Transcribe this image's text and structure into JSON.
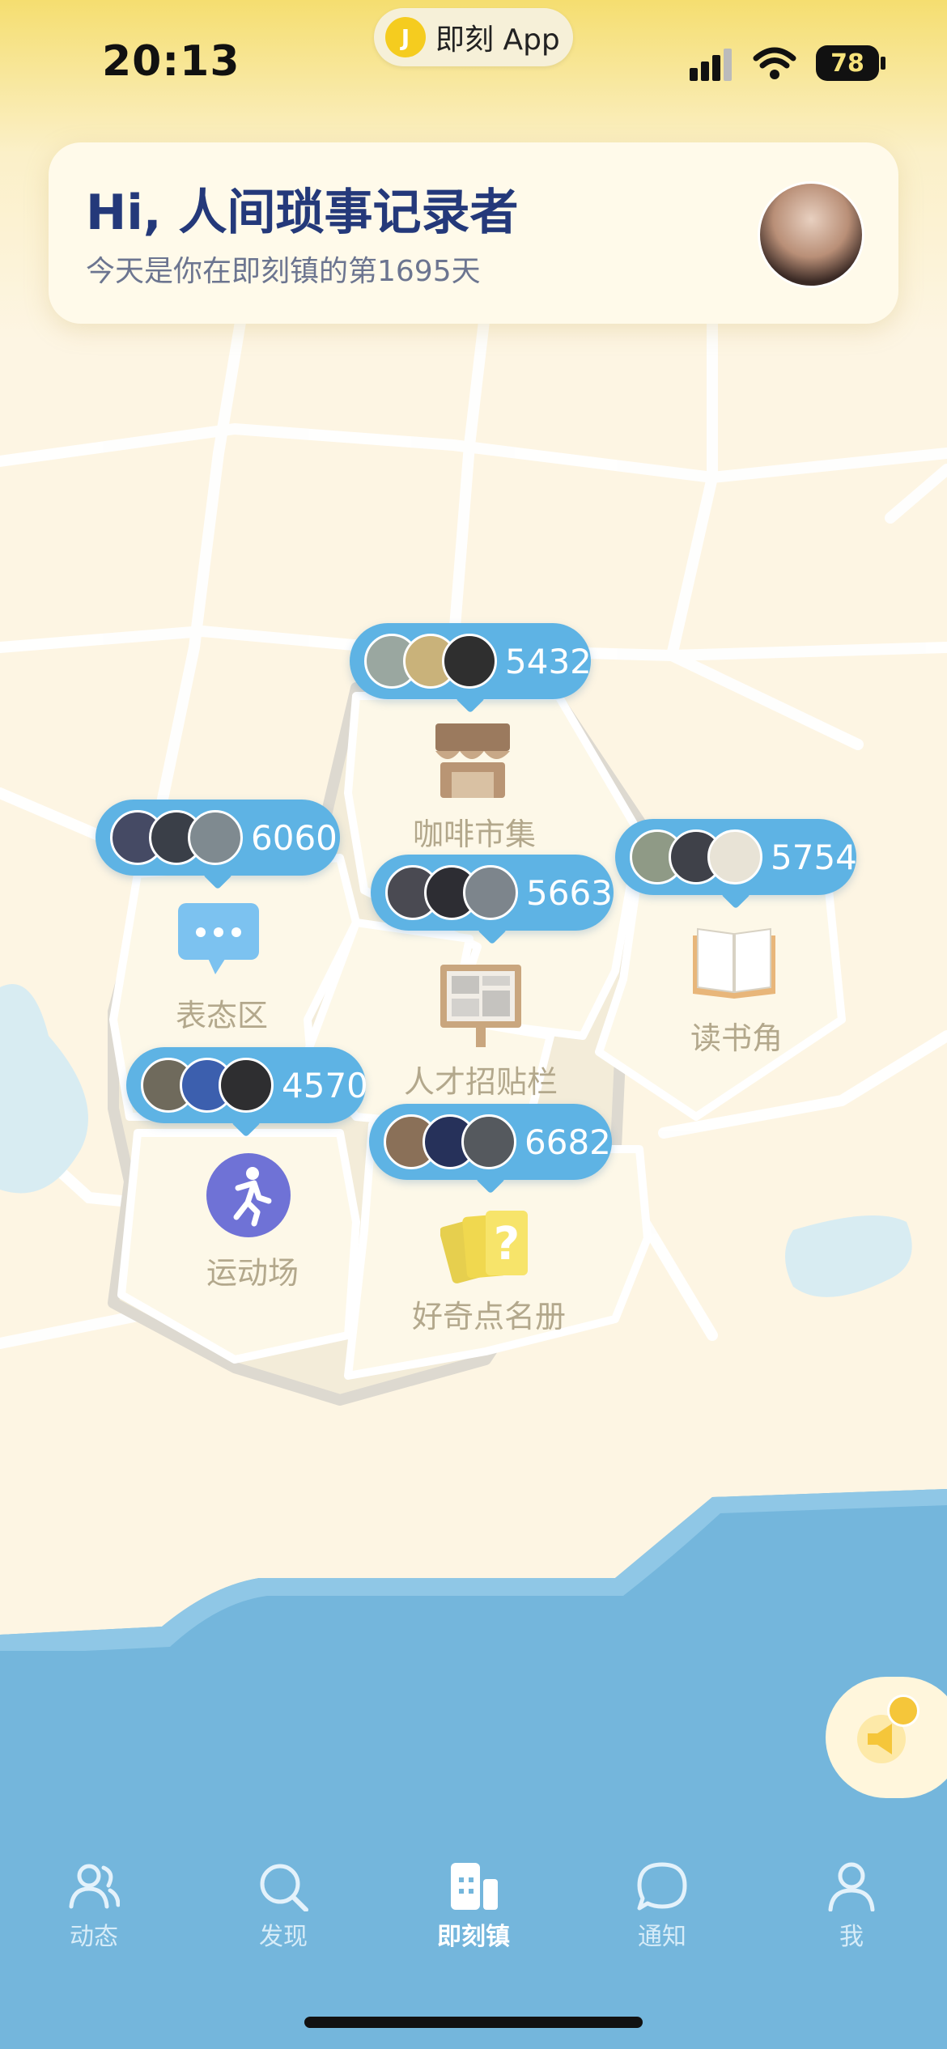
{
  "status_bar": {
    "time": "20:13",
    "app_pill": "即刻 App",
    "battery": "78"
  },
  "greeting": {
    "title": "Hi, 人间琐事记录者",
    "subtitle": "今天是你在即刻镇的第1695天"
  },
  "places": [
    {
      "id": "coffee",
      "label": "咖啡市集",
      "count": "5432",
      "icon": "market-stall-icon"
    },
    {
      "id": "opinion",
      "label": "表态区",
      "count": "6060",
      "icon": "chat-bubble-icon"
    },
    {
      "id": "jobs",
      "label": "人才招贴栏",
      "count": "5663",
      "icon": "notice-board-icon"
    },
    {
      "id": "reading",
      "label": "读书角",
      "count": "5754",
      "icon": "open-book-icon"
    },
    {
      "id": "sports",
      "label": "运动场",
      "count": "4570",
      "icon": "runner-icon"
    },
    {
      "id": "curious",
      "label": "好奇点名册",
      "count": "6682",
      "icon": "question-cards-icon"
    }
  ],
  "colors": {
    "accent": "#5eb3e4",
    "sea": "#74b6dc",
    "land": "#fdf5e3",
    "title": "#24397a"
  },
  "tabbar": {
    "active": "即刻镇",
    "tabs": [
      {
        "label": "动态",
        "icon": "people-icon"
      },
      {
        "label": "发现",
        "icon": "search-icon"
      },
      {
        "label": "即刻镇",
        "icon": "town-building-icon"
      },
      {
        "label": "通知",
        "icon": "speech-bubble-icon"
      },
      {
        "label": "我",
        "icon": "person-icon"
      }
    ]
  }
}
